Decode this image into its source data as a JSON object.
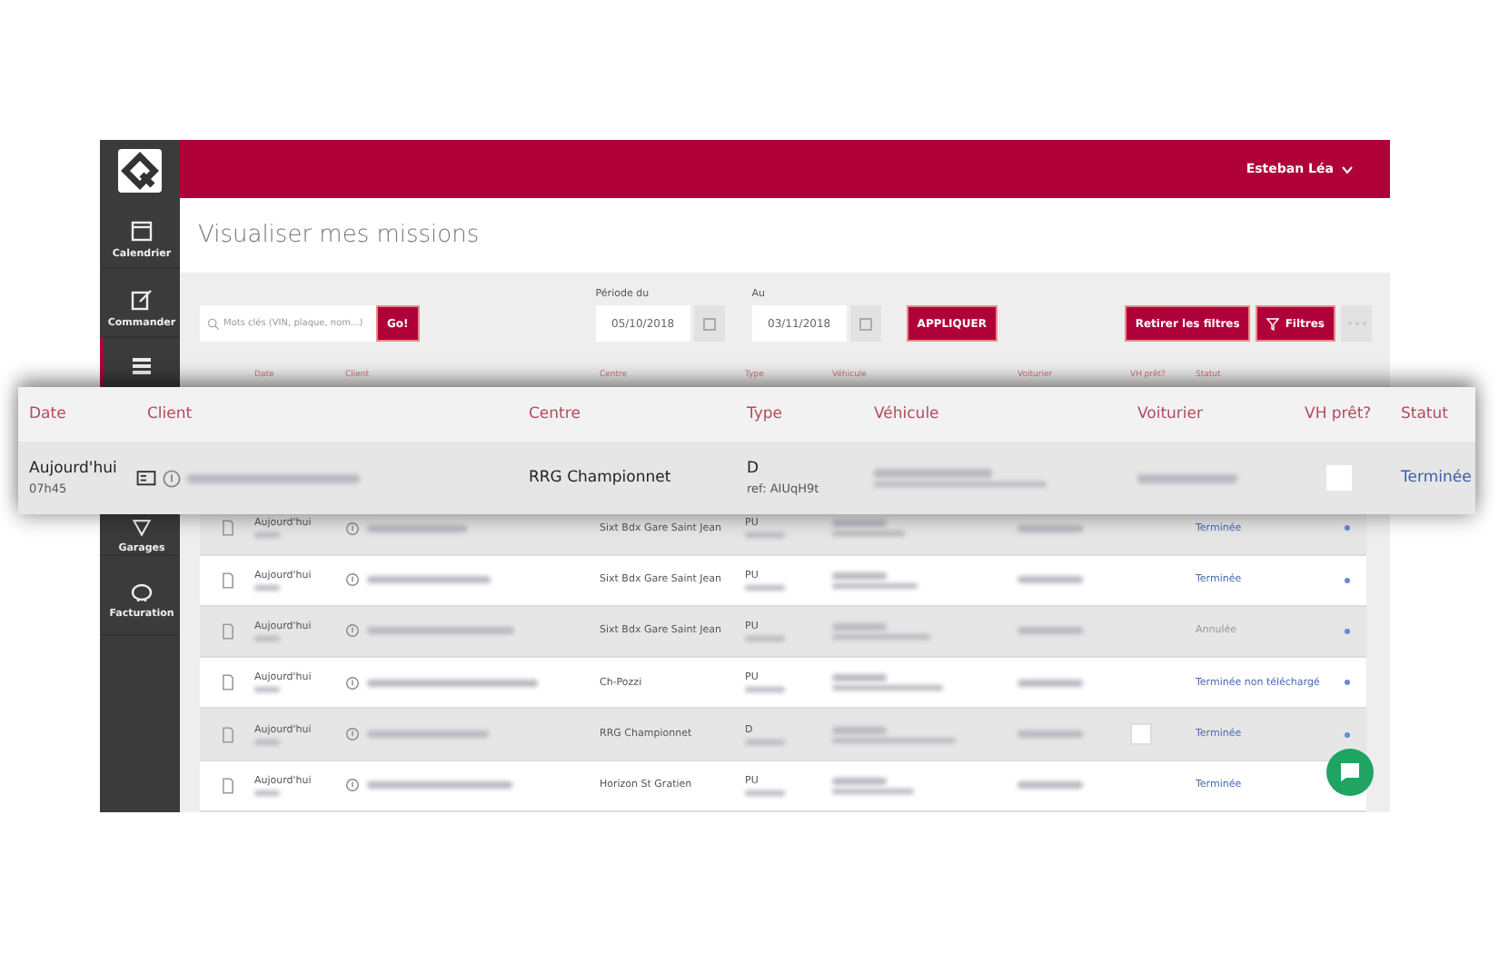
{
  "header": {
    "user": "Esteban Léa"
  },
  "sidebar": {
    "items": [
      {
        "kind": "calendar",
        "label": "Calendrier",
        "selected": false
      },
      {
        "kind": "edit",
        "label": "Commander",
        "selected": false
      },
      {
        "kind": "list",
        "selected": true
      },
      {
        "kind": "pin",
        "label": "Garages",
        "selected": false
      },
      {
        "kind": "piggy",
        "label": "Facturation",
        "selected": false
      }
    ]
  },
  "page_title": "Visualiser mes missions",
  "toolbar": {
    "search": {
      "placeholder": "Mots clés (VIN, plaque, nom...)",
      "button": "Go!"
    },
    "from": {
      "label": "Période du",
      "value": "05/10/2018"
    },
    "to": {
      "label": "Au",
      "value": "03/11/2018"
    },
    "apply": "APPLIQUER",
    "clear": "Retirer les filtres",
    "filters": "Filtres"
  },
  "table": {
    "columns": [
      "Date",
      "Client",
      "Centre",
      "Type",
      "Véhicule",
      "Voiturier",
      "VH prêt?",
      "Statut"
    ],
    "rows": [
      {
        "date": "Aujourd'hui",
        "centre": "Sixt Bdx Gare Saint Jean",
        "type": "PU",
        "status": "Terminée",
        "cancelled": false
      },
      {
        "date": "Aujourd'hui",
        "centre": "Sixt Bdx Gare Saint Jean",
        "type": "PU",
        "status": "Terminée",
        "cancelled": false
      },
      {
        "date": "Aujourd'hui",
        "centre": "Sixt Bdx Gare Saint Jean",
        "type": "PU",
        "status": "Annulée",
        "cancelled": true
      },
      {
        "date": "Aujourd'hui",
        "centre": "Ch-Pozzi",
        "type": "PU",
        "status": "Terminée non téléchargé",
        "cancelled": false
      },
      {
        "date": "Aujourd'hui",
        "centre": "RRG Championnet",
        "type": "D",
        "status": "Terminée",
        "cancelled": false,
        "vh_ready": false
      },
      {
        "date": "Aujourd'hui",
        "centre": "Horizon St Gratien",
        "type": "PU",
        "status": "Terminée",
        "cancelled": false
      }
    ]
  },
  "zoomed_row": {
    "columns": [
      "Date",
      "Client",
      "Centre",
      "Type",
      "Véhicule",
      "Voiturier",
      "VH prêt?",
      "Statut"
    ],
    "date": "Aujourd'hui",
    "time": "07h45",
    "centre": "RRG Championnet",
    "type": "D",
    "ref": "ref: AIUqH9t",
    "status": "Terminée",
    "vh_ready": false
  }
}
